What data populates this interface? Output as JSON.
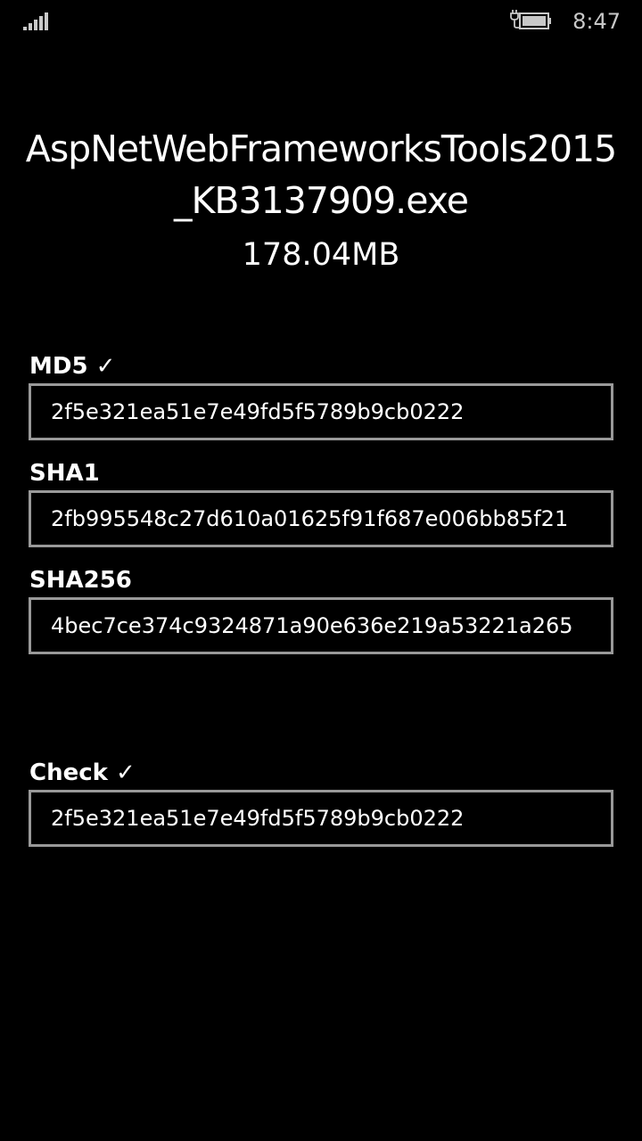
{
  "status_bar": {
    "time": "8:47",
    "signal_icon": "signal-strength-icon",
    "battery_icon": "battery-charging-icon"
  },
  "file": {
    "name": "AspNetWebFrameworksTools2015_KB3137909.exe",
    "size": "178.04MB"
  },
  "hashes": {
    "md5": {
      "label": "MD5 ✓",
      "value": "2f5e321ea51e7e49fd5f5789b9cb0222"
    },
    "sha1": {
      "label": "SHA1",
      "value": "2fb995548c27d610a01625f91f687e006bb85f21"
    },
    "sha256": {
      "label": "SHA256",
      "value": "4bec7ce374c9324871a90e636e219a53221a265"
    }
  },
  "check": {
    "label": "Check ✓",
    "value": "2f5e321ea51e7e49fd5f5789b9cb0222"
  },
  "colors": {
    "background": "#000000",
    "text": "#ffffff",
    "field_border": "#999999",
    "status_text": "#c8c8c8"
  }
}
